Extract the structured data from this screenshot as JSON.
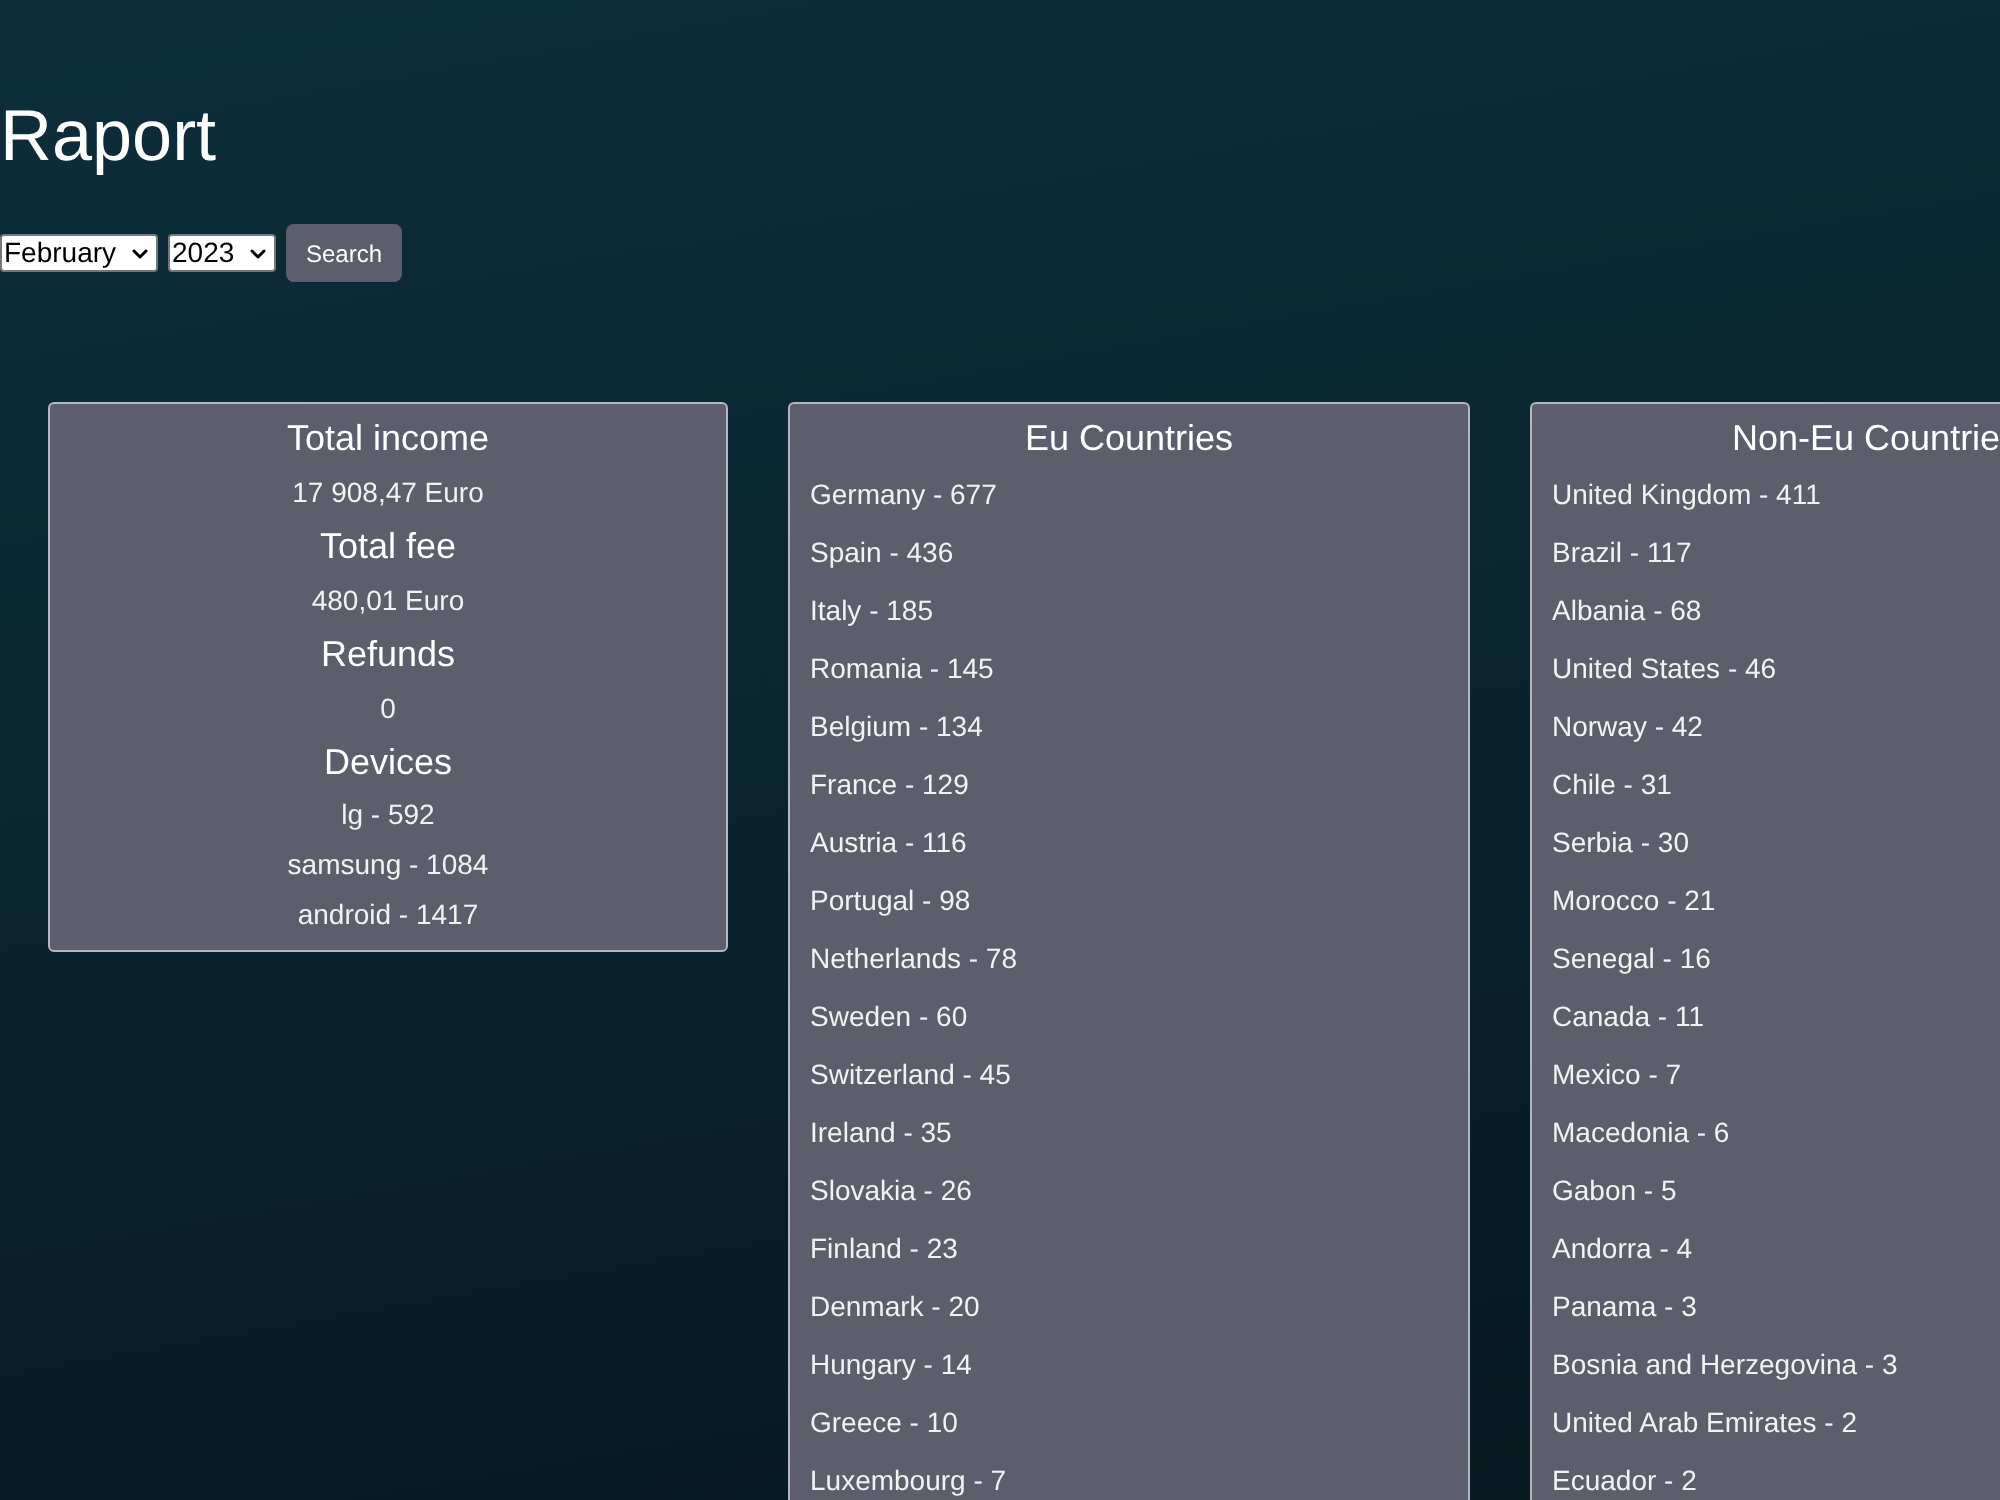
{
  "page": {
    "title": "Raport"
  },
  "filters": {
    "month": "February",
    "year": "2023",
    "button": "Search"
  },
  "summary": {
    "sections": [
      {
        "heading": "Total income",
        "items": [
          "17 908,47 Euro"
        ]
      },
      {
        "heading": "Total fee",
        "items": [
          "480,01 Euro"
        ]
      },
      {
        "heading": "Refunds",
        "items": [
          "0"
        ]
      },
      {
        "heading": "Devices",
        "items": [
          "lg - 592",
          "samsung - 1084",
          "android - 1417"
        ]
      }
    ]
  },
  "eu_countries": {
    "title": "Eu Countries",
    "items": [
      "Germany - 677",
      "Spain - 436",
      "Italy - 185",
      "Romania - 145",
      "Belgium - 134",
      "France - 129",
      "Austria - 116",
      "Portugal - 98",
      "Netherlands - 78",
      "Sweden - 60",
      "Switzerland - 45",
      "Ireland - 35",
      "Slovakia - 26",
      "Finland - 23",
      "Denmark - 20",
      "Hungary - 14",
      "Greece - 10",
      "Luxembourg - 7"
    ]
  },
  "non_eu_countries": {
    "title": "Non-Eu Countrie",
    "items": [
      "United Kingdom - 411",
      "Brazil - 117",
      "Albania - 68",
      "United States - 46",
      "Norway - 42",
      "Chile - 31",
      "Serbia - 30",
      "Morocco - 21",
      "Senegal - 16",
      "Canada - 11",
      "Mexico - 7",
      "Macedonia - 6",
      "Gabon - 5",
      "Andorra - 4",
      "Panama - 3",
      "Bosnia and Herzegovina - 3",
      "United Arab Emirates - 2",
      "Ecuador - 2"
    ]
  }
}
